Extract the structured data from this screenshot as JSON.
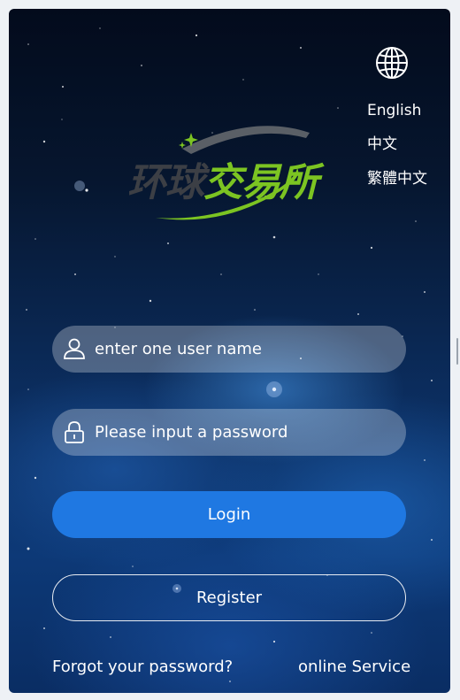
{
  "languages": {
    "english": "English",
    "simplified_chinese": "中文",
    "traditional_chinese": "繁體中文"
  },
  "logo": {
    "text": "环球交易所"
  },
  "login_form": {
    "username_placeholder": "enter one user name",
    "password_placeholder": "Please input a password",
    "login_label": "Login",
    "register_label": "Register",
    "forgot_password_label": "Forgot your password?",
    "online_service_label": "online Service"
  },
  "icons": {
    "language": "globe-icon",
    "username": "user-icon",
    "password": "lock-icon"
  },
  "colors": {
    "primary_button": "#1f78e2",
    "logo_green": "#7cc422",
    "logo_dark": "#3c3f45"
  }
}
